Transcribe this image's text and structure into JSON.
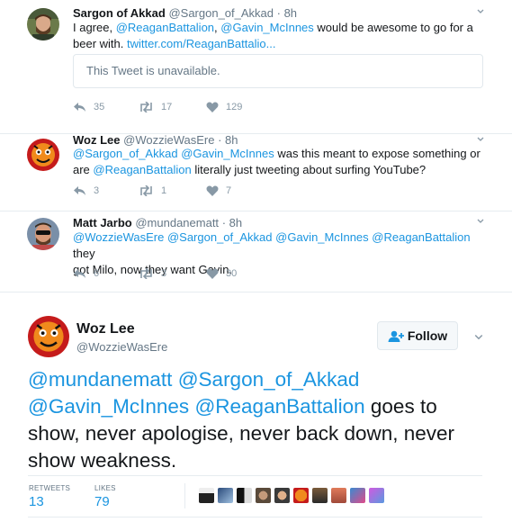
{
  "replies": [
    {
      "name": "Sargon of Akkad",
      "handle": "@Sargon_of_Akkad",
      "time": "· 8h",
      "line1": {
        "t1": "I agree, ",
        "m1": "@ReaganBattalion",
        "t2": ",  ",
        "m2": "@Gavin_McInnes",
        "t3": " would be awesome to go for a"
      },
      "line2": {
        "t1": "beer with. ",
        "link": "twitter.com/ReaganBattalio..."
      },
      "quoted": "This Tweet is unavailable.",
      "replies": "35",
      "retweets": "17",
      "likes": "129"
    },
    {
      "name": "Woz Lee",
      "handle": "@WozzieWasEre",
      "time": "· 8h",
      "line1": {
        "m1": "@Sargon_of_Akkad",
        "m2": "@Gavin_McInnes",
        "t1": " was this meant to expose something or"
      },
      "line2": {
        "t1": "are ",
        "m1": "@ReaganBattalion",
        "t2": " literally just tweeting about surfing YouTube?"
      },
      "replies": "3",
      "retweets": "1",
      "likes": "7"
    },
    {
      "name": "Matt Jarbo",
      "handle": "@mundanematt",
      "time": "· 8h",
      "line1": {
        "m1": "@WozzieWasEre",
        "m2": "@Sargon_of_Akkad",
        "m3": "@Gavin_McInnes",
        "m4": "@ReaganBattalion",
        "t1": " they"
      },
      "line2": {
        "t1": "got Milo, now they want Gavin."
      },
      "replies": "6",
      "retweets": "3",
      "likes": "30"
    }
  ],
  "main": {
    "name": "Woz Lee",
    "handle": "@WozzieWasEre",
    "follow_label": "Follow",
    "mentions": [
      "@mundanematt",
      "@Sargon_of_Akkad",
      "@Gavin_McInnes",
      "@ReaganBattalion"
    ],
    "text_after": " goes to show, never apologise, never back down, never show weakness.",
    "retweets_label": "RETWEETS",
    "retweets": "13",
    "likes_label": "LIKES",
    "likes": "79"
  },
  "colors": {
    "link": "#1b95e0",
    "action_gray": "#8899a6",
    "border": "#e6ecf0"
  }
}
